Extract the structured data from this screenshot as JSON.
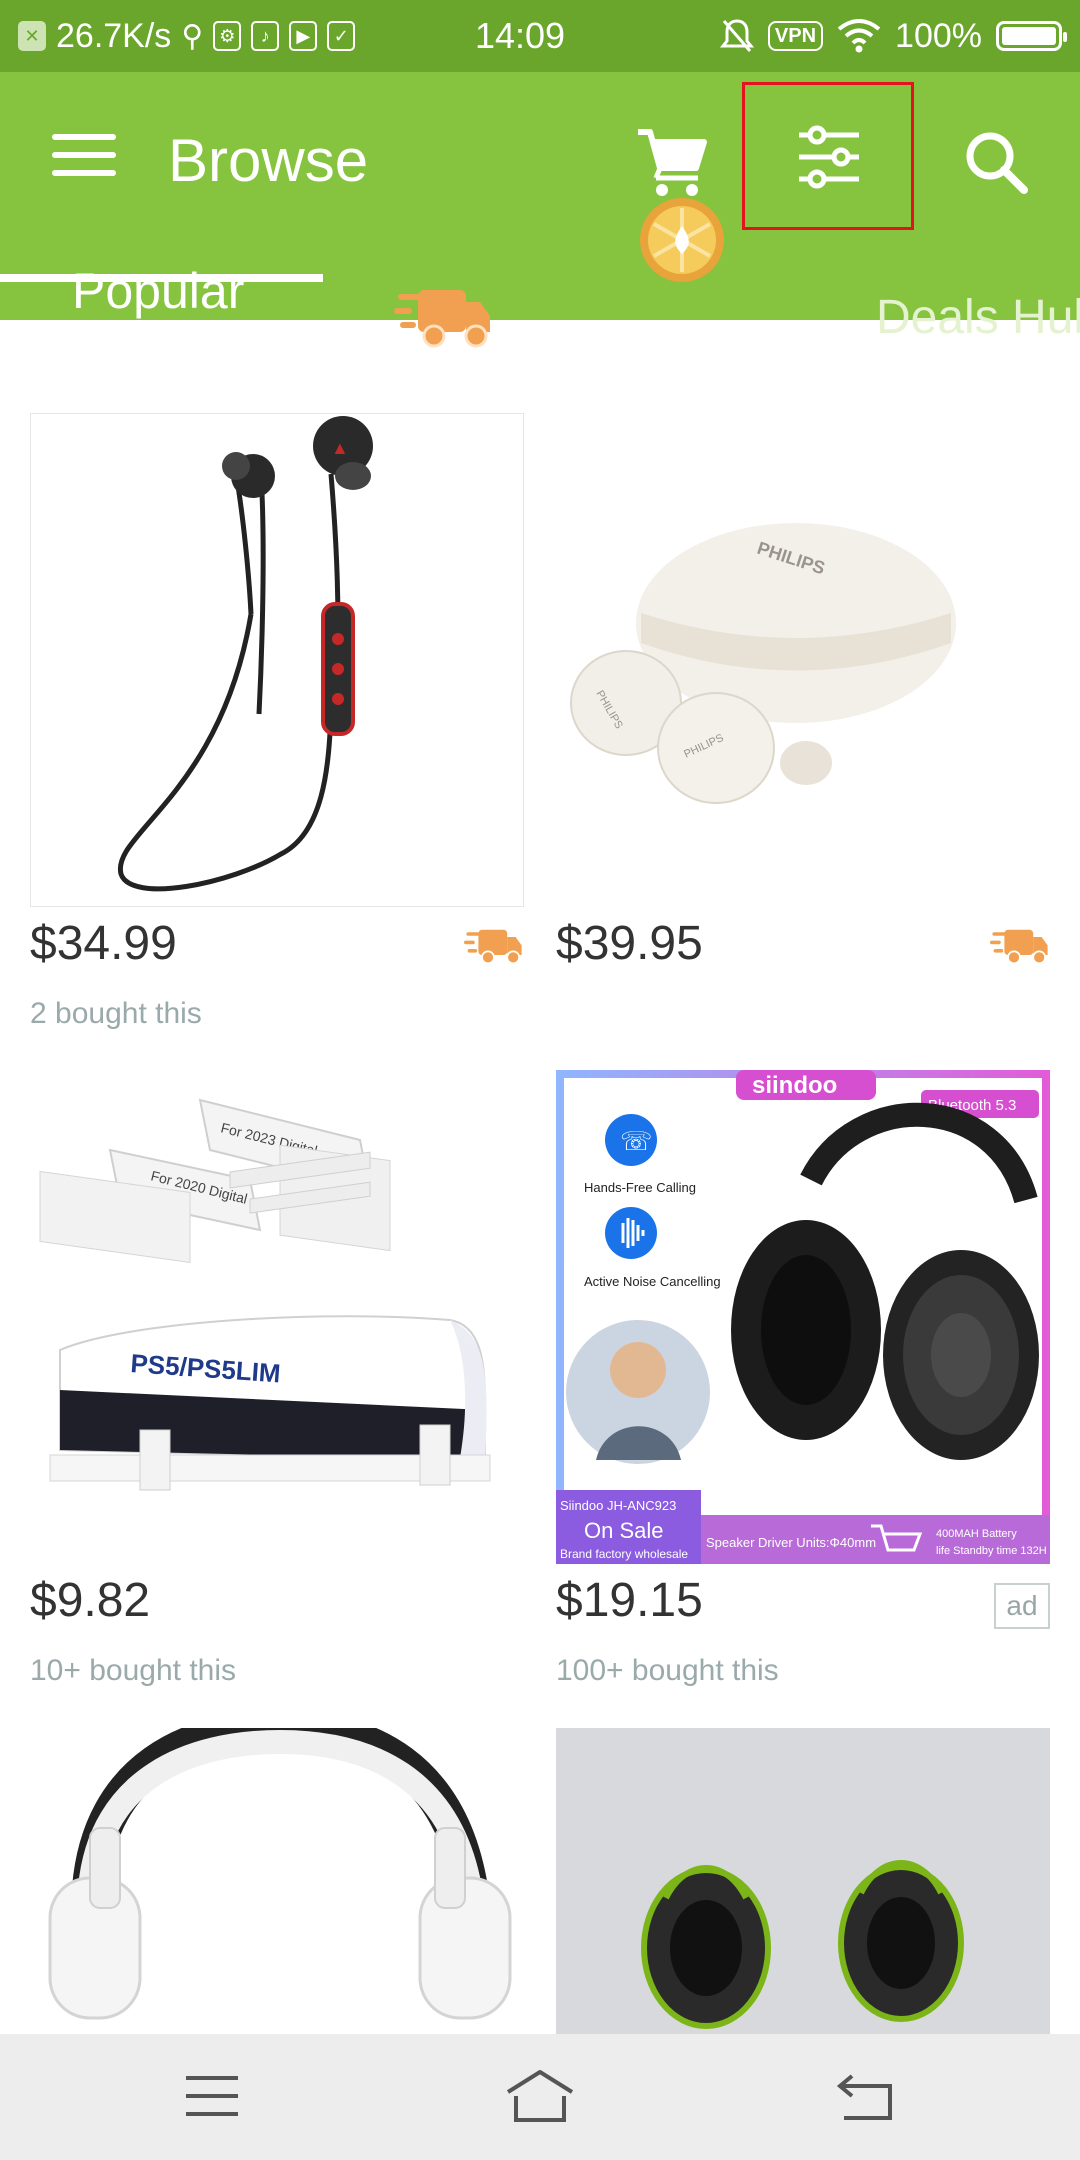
{
  "status_bar": {
    "speed": "26.7K/s",
    "time": "14:09",
    "vpn": "VPN",
    "battery": "100%",
    "battery_level": 1.0
  },
  "app_bar": {
    "title": "Browse"
  },
  "tabs": [
    {
      "label": "Popular",
      "selected": true
    },
    {
      "icon": "delivery-truck-icon"
    },
    {
      "icon": "coins-icon"
    },
    {
      "label": "Deals Hub"
    }
  ],
  "products": [
    {
      "price": "$34.99",
      "sold": "2 bought this",
      "fast_delivery": true
    },
    {
      "price": "$39.95",
      "sold": "",
      "fast_delivery": true
    },
    {
      "price": "$9.82",
      "sold": "10+ bought this"
    },
    {
      "price": "$19.15",
      "sold": "100+ bought this",
      "ad": "ad"
    },
    {
      "price": "",
      "sold": ""
    },
    {
      "price": "",
      "sold": ""
    }
  ],
  "product_images": {
    "philips": "PHILIPS",
    "stand_labels": [
      "For 2023 Digital",
      "For 2020 Digital",
      "PS5/PS5LIM"
    ],
    "siindoo": {
      "brand": "siindoo",
      "bluetooth": "Bluetooth 5.3",
      "features": [
        "Hands-Free Calling",
        "Active Noise Cancelling"
      ],
      "model": "Siindoo JH-ANC923",
      "on_sale": "On Sale",
      "wholesale": "Brand factory wholesale",
      "driver": "Speaker Driver Units:Φ40mm",
      "battery_line1": "400MAH Battery",
      "battery_line2": "life Standby time 132H"
    }
  },
  "colors": {
    "status_bar": "#6aa62c",
    "app_bar": "#86c440",
    "highlight_box": "#e3141e",
    "delivery_orange": "#f0a050",
    "nav_bar": "#ededed"
  }
}
